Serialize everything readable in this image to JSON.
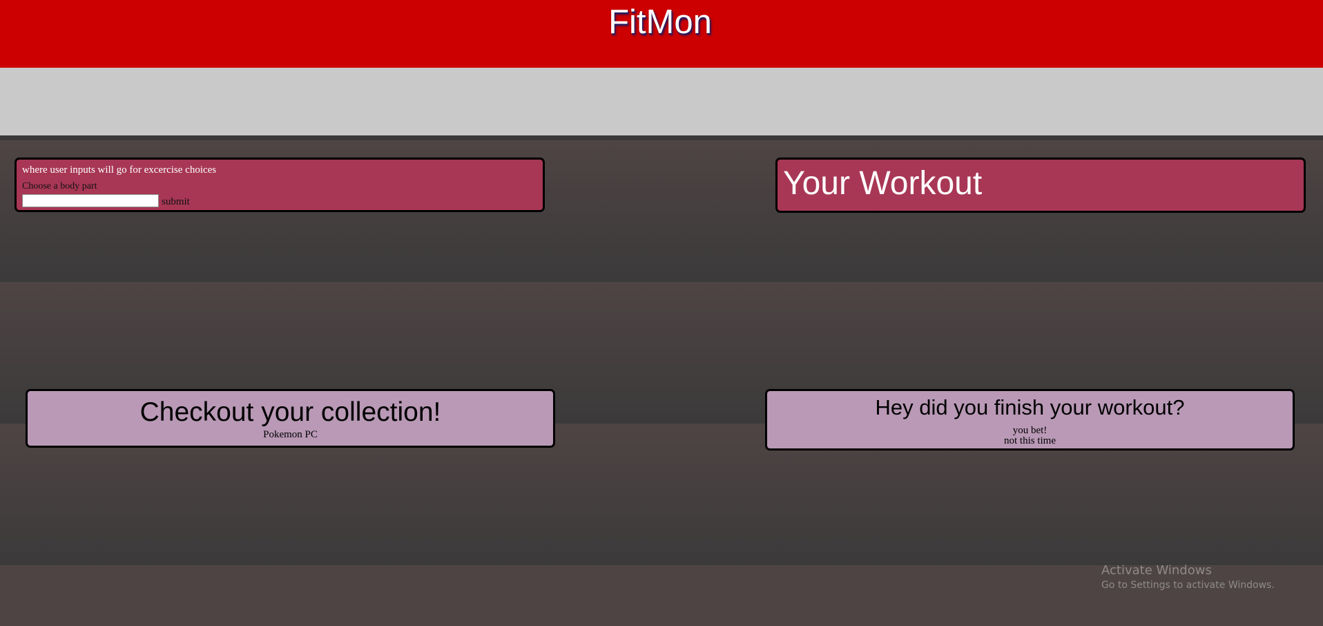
{
  "header": {
    "title": "FitMon"
  },
  "exercise_input": {
    "heading": "where user inputs will go for excercise choices",
    "label": "Choose a body part",
    "input_value": "",
    "submit_label": "submit"
  },
  "workout": {
    "title": "Your Workout"
  },
  "collection": {
    "title": "Checkout your collection!",
    "link_label": "Pokemon PC"
  },
  "finish": {
    "title": "Hey did you finish your workout?",
    "yes_label": "you bet!",
    "no_label": "not this time"
  },
  "watermark": {
    "title": "Activate Windows",
    "subtitle": "Go to Settings to activate Windows."
  },
  "colors": {
    "header": "#cc0000",
    "panel_red": "#a83755",
    "panel_mauve": "#b999b6",
    "gray_band": "#c9c9c9",
    "background": "#3b3939"
  }
}
